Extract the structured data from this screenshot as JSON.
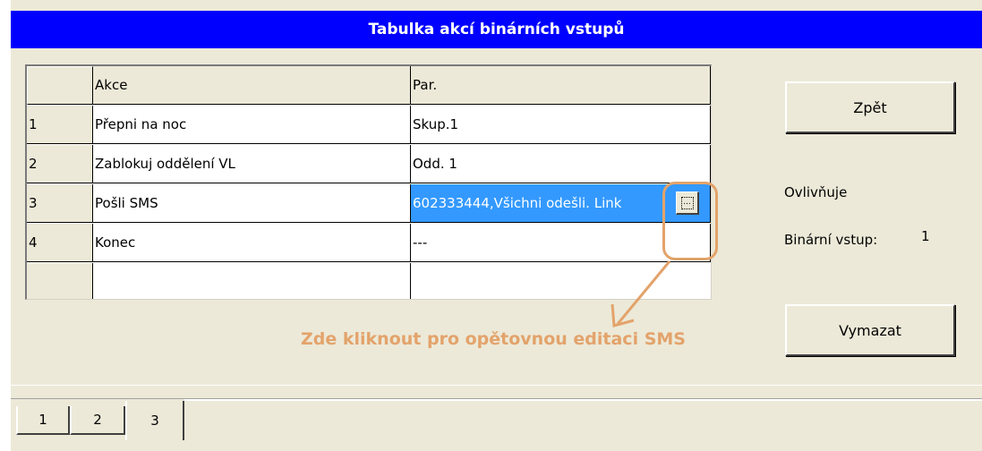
{
  "window": {
    "title": "Tabulka akcí binárních vstupů"
  },
  "grid": {
    "headers": {
      "col0": "",
      "col1": "Akce",
      "col2": "Par."
    },
    "rows": [
      {
        "num": "1",
        "action": "Přepni na noc",
        "param": "Skup.1"
      },
      {
        "num": "2",
        "action": "Zablokuj oddělení VL",
        "param": "Odd. 1"
      },
      {
        "num": "3",
        "action": "Pošli SMS",
        "param": "602333444,Všichni odešli. Link"
      },
      {
        "num": "4",
        "action": "Konec",
        "param": "---"
      }
    ],
    "selected_row": 3,
    "edit_button_icon": "ellipsis-icon"
  },
  "buttons": {
    "back": "Zpět",
    "clear": "Vymazat"
  },
  "info": {
    "affects_label": "Ovlivňuje",
    "binary_input_label": "Binární vstup:",
    "binary_input_value": "1"
  },
  "annotation": {
    "text": "Zde kliknout pro opětovnou editaci SMS",
    "color": "#e3a36b"
  },
  "tabs": [
    {
      "label": "1"
    },
    {
      "label": "2"
    },
    {
      "label": "3",
      "active": true
    }
  ],
  "colors": {
    "titlebar": "#0000ff",
    "selection": "#3399ff",
    "face": "#ece9d8"
  }
}
